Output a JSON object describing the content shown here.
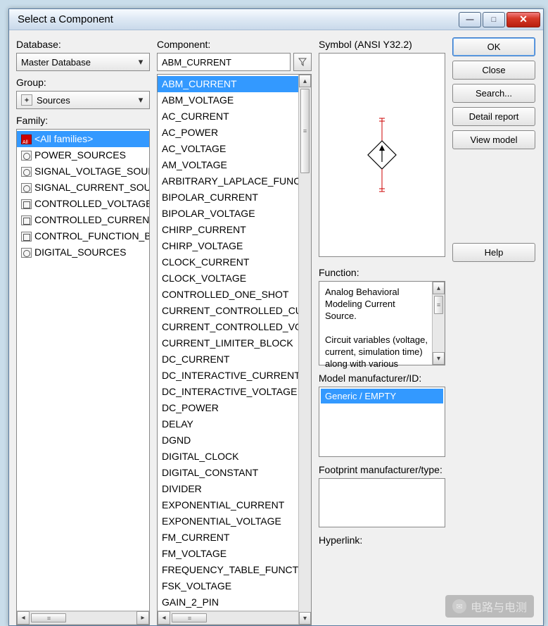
{
  "window": {
    "title": "Select a Component"
  },
  "winbtns": {
    "min": "—",
    "max": "□",
    "close": "✕"
  },
  "labels": {
    "database": "Database:",
    "group": "Group:",
    "family": "Family:",
    "component": "Component:",
    "symbol": "Symbol (ANSI Y32.2)",
    "function": "Function:",
    "model": "Model manufacturer/ID:",
    "footprint": "Footprint manufacturer/type:",
    "hyperlink": "Hyperlink:"
  },
  "database_value": "Master Database",
  "group_value": "Sources",
  "component_value": "ABM_CURRENT",
  "families": [
    "<All families>",
    "POWER_SOURCES",
    "SIGNAL_VOLTAGE_SOURCES",
    "SIGNAL_CURRENT_SOURCES",
    "CONTROLLED_VOLTAGE_SOURCES",
    "CONTROLLED_CURRENT_SOURCES",
    "CONTROL_FUNCTION_BLOCKS",
    "DIGITAL_SOURCES"
  ],
  "family_selected_index": 0,
  "components": [
    "ABM_CURRENT",
    "ABM_VOLTAGE",
    "AC_CURRENT",
    "AC_POWER",
    "AC_VOLTAGE",
    "AM_VOLTAGE",
    "ARBITRARY_LAPLACE_FUNCTION",
    "BIPOLAR_CURRENT",
    "BIPOLAR_VOLTAGE",
    "CHIRP_CURRENT",
    "CHIRP_VOLTAGE",
    "CLOCK_CURRENT",
    "CLOCK_VOLTAGE",
    "CONTROLLED_ONE_SHOT",
    "CURRENT_CONTROLLED_CURRENT_SOURCE",
    "CURRENT_CONTROLLED_VOLTAGE_SOURCE",
    "CURRENT_LIMITER_BLOCK",
    "DC_CURRENT",
    "DC_INTERACTIVE_CURRENT",
    "DC_INTERACTIVE_VOLTAGE",
    "DC_POWER",
    "DELAY",
    "DGND",
    "DIGITAL_CLOCK",
    "DIGITAL_CONSTANT",
    "DIVIDER",
    "EXPONENTIAL_CURRENT",
    "EXPONENTIAL_VOLTAGE",
    "FM_CURRENT",
    "FM_VOLTAGE",
    "FREQUENCY_TABLE_FUNCTION",
    "FSK_VOLTAGE",
    "GAIN_2_PIN"
  ],
  "component_selected_index": 0,
  "buttons": {
    "ok": "OK",
    "close": "Close",
    "search": "Search...",
    "detail": "Detail report",
    "viewmodel": "View model",
    "help": "Help"
  },
  "function_text": "Analog Behavioral Modeling Current Source.\n\nCircuit variables (voltage, current, simulation time) along with various",
  "model_value": "Generic / EMPTY",
  "watermark": "电路与电测"
}
